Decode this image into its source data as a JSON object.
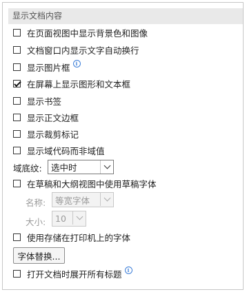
{
  "section": {
    "title": "显示文档内容"
  },
  "options": [
    {
      "label": "在页面视图中显示背景色和图像",
      "checked": false
    },
    {
      "label": "文档窗口内显示文字自动换行",
      "checked": false
    },
    {
      "label": "显示图片框",
      "checked": false,
      "info": true
    },
    {
      "label": "在屏幕上显示图形和文本框",
      "checked": true
    },
    {
      "label": "显示书签",
      "checked": false
    },
    {
      "label": "显示正文边框",
      "checked": false
    },
    {
      "label": "显示裁剪标记",
      "checked": false
    },
    {
      "label": "显示域代码而非域值",
      "checked": false
    }
  ],
  "field_shading": {
    "label": "域底纹:",
    "value": "选中时"
  },
  "draft_font": {
    "label": "在草稿和大纲视图中使用草稿字体",
    "checked": false
  },
  "font_name": {
    "label": "名称:",
    "value": "等宽字体"
  },
  "font_size": {
    "label": "大小:",
    "value": "10"
  },
  "printer_fonts": {
    "label": "使用存储在打印机上的字体",
    "checked": false
  },
  "font_substitution": {
    "label": "字体替换..."
  },
  "expand_headings": {
    "label": "打开文档时展开所有标题",
    "checked": false,
    "info": true
  },
  "icons": {
    "info": "info-icon",
    "dropdown": "chevron-down-icon",
    "check": "checkmark-icon"
  },
  "colors": {
    "info": "#3b7dd8",
    "header_bg": "#e9e9e9",
    "disabled_text": "#9a9a9a"
  }
}
